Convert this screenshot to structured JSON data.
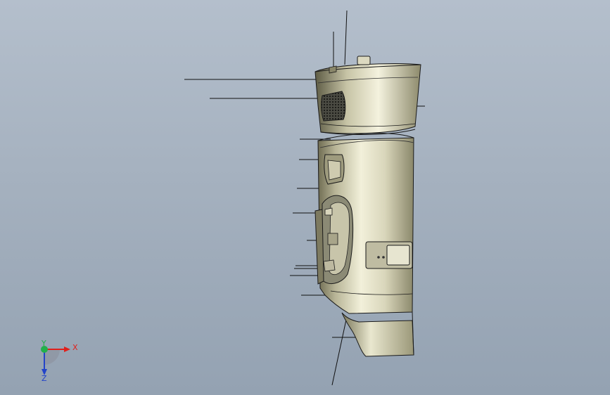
{
  "viewport": {
    "background_top": "#b4bfcc",
    "background_bottom": "#94a2b2"
  },
  "model": {
    "body_color": "#d4d1b8",
    "edge_color": "#1a1a1a",
    "grille_color": "#2a2a2a",
    "leader_color": "#111111"
  },
  "triad": {
    "x_label": "X",
    "y_label": "Y",
    "z_label": "Z",
    "x_color": "#e0201b",
    "y_color": "#22b04a",
    "z_color": "#2343c9",
    "icon": "coordinate-triad-icon"
  }
}
